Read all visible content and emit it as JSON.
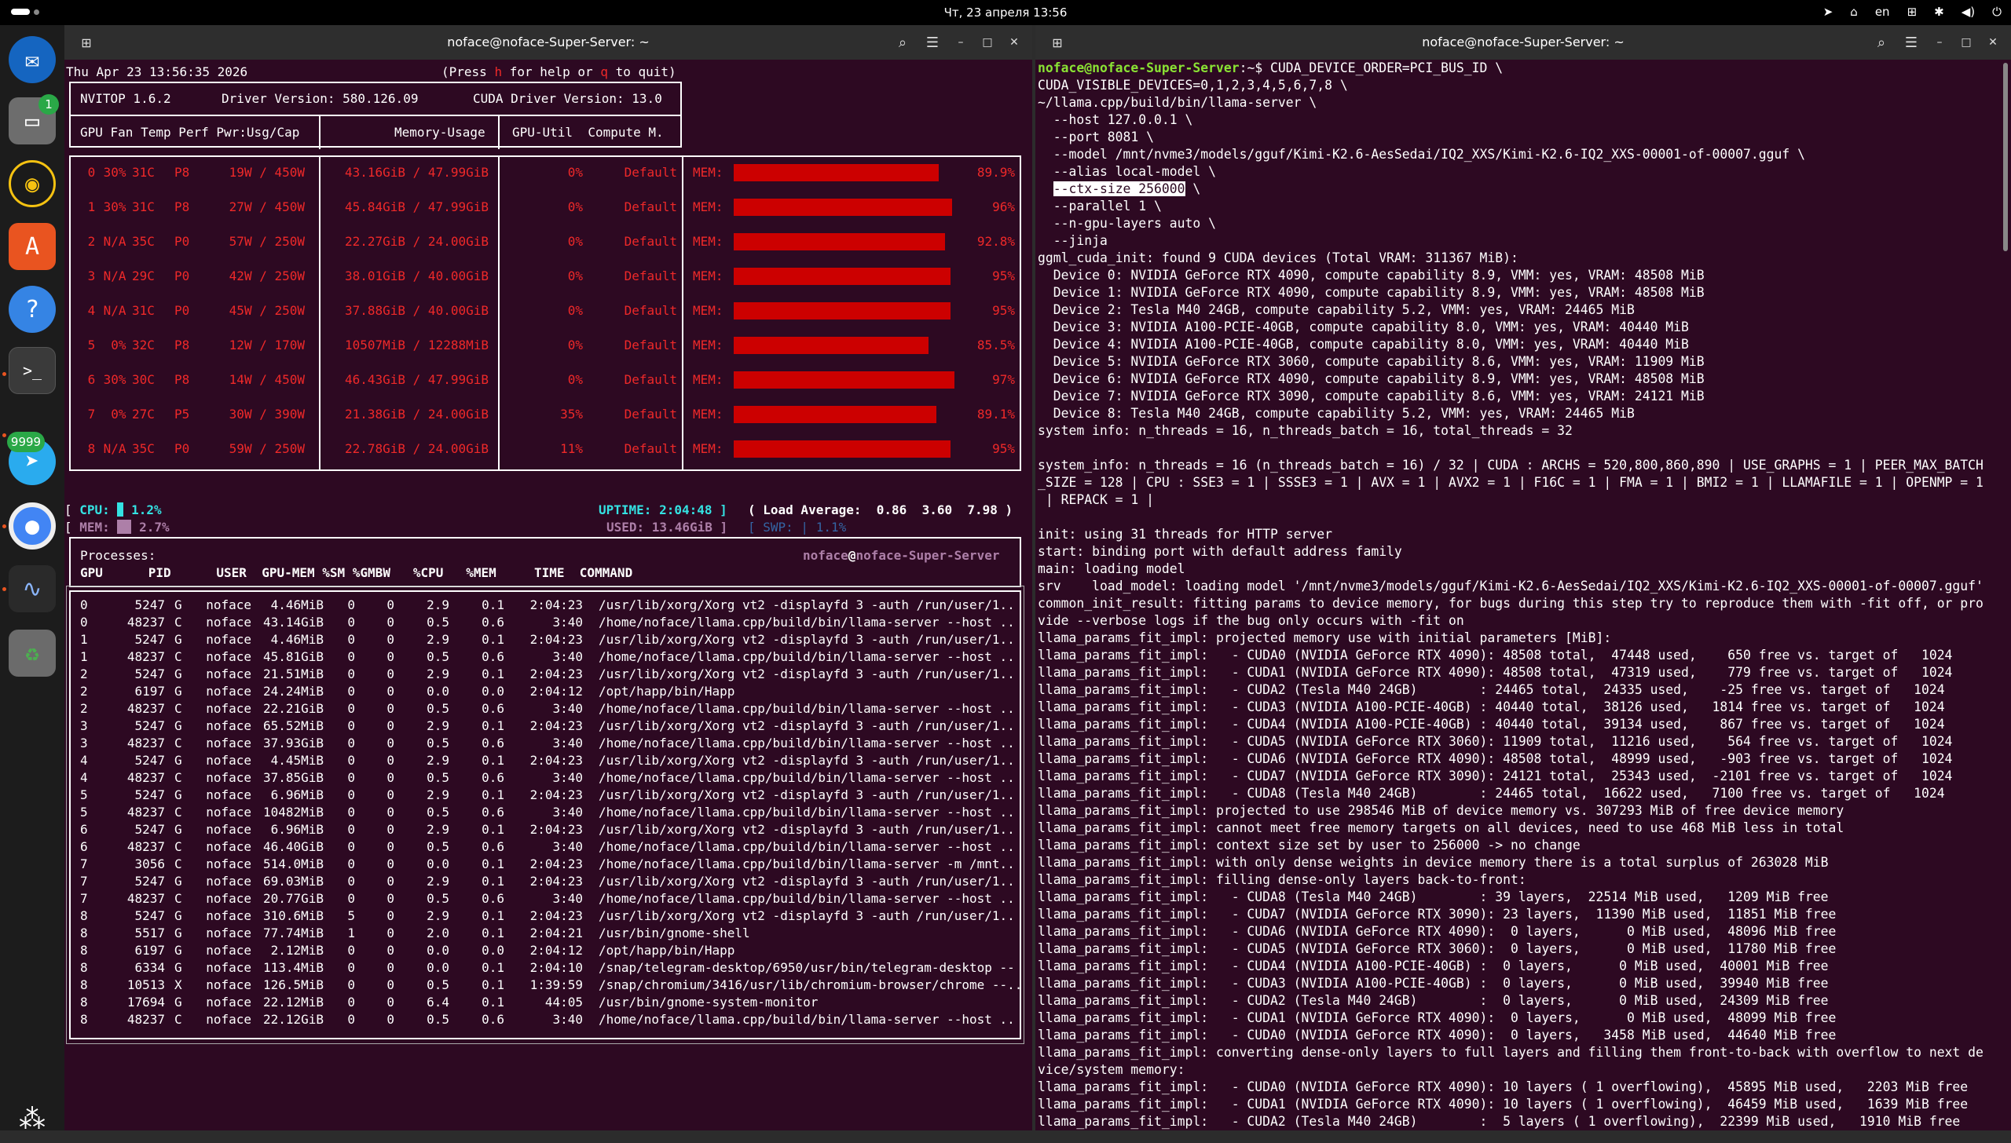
{
  "topbar": {
    "clock": "Чт, 23 апреля 13:56",
    "lang": "en"
  },
  "dock": {
    "badges": {
      "files": "1",
      "telegram": "9999"
    }
  },
  "left_window": {
    "title": "noface@noface-Super-Server: ~",
    "header": {
      "date": "Thu Apr 23 13:56:35 2026",
      "help": "(Press h for help or q to quit)"
    },
    "nvitop": {
      "version": "NVITOP 1.6.2",
      "driver": "Driver Version: 580.126.09",
      "cuda": "CUDA Driver Version: 13.0",
      "col_gpu": "GPU Fan Temp Perf Pwr:Usg/Cap",
      "col_mem": "Memory-Usage",
      "col_util": "GPU-Util  Compute M."
    },
    "gpus": [
      {
        "id": "0",
        "fan": "30%",
        "temp": "31C",
        "perf": "P8",
        "pwr": "19W / 450W",
        "mem": "43.16GiB / 47.99GiB",
        "util": "0%",
        "mode": "Default",
        "pct": "89.9%",
        "frac": 0.899
      },
      {
        "id": "1",
        "fan": "30%",
        "temp": "31C",
        "perf": "P8",
        "pwr": "27W / 450W",
        "mem": "45.84GiB / 47.99GiB",
        "util": "0%",
        "mode": "Default",
        "pct": "96%",
        "frac": 0.96
      },
      {
        "id": "2",
        "fan": "N/A",
        "temp": "35C",
        "perf": "P0",
        "pwr": "57W / 250W",
        "mem": "22.27GiB / 24.00GiB",
        "util": "0%",
        "mode": "Default",
        "pct": "92.8%",
        "frac": 0.928
      },
      {
        "id": "3",
        "fan": "N/A",
        "temp": "29C",
        "perf": "P0",
        "pwr": "42W / 250W",
        "mem": "38.01GiB / 40.00GiB",
        "util": "0%",
        "mode": "Default",
        "pct": "95%",
        "frac": 0.95
      },
      {
        "id": "4",
        "fan": "N/A",
        "temp": "31C",
        "perf": "P0",
        "pwr": "45W / 250W",
        "mem": "37.88GiB / 40.00GiB",
        "util": "0%",
        "mode": "Default",
        "pct": "95%",
        "frac": 0.95
      },
      {
        "id": "5",
        "fan": "0%",
        "temp": "32C",
        "perf": "P8",
        "pwr": "12W / 170W",
        "mem": "10507MiB / 12288MiB",
        "util": "0%",
        "mode": "Default",
        "pct": "85.5%",
        "frac": 0.855
      },
      {
        "id": "6",
        "fan": "30%",
        "temp": "30C",
        "perf": "P8",
        "pwr": "14W / 450W",
        "mem": "46.43GiB / 47.99GiB",
        "util": "0%",
        "mode": "Default",
        "pct": "97%",
        "frac": 0.97
      },
      {
        "id": "7",
        "fan": "0%",
        "temp": "27C",
        "perf": "P5",
        "pwr": "30W / 390W",
        "mem": "21.38GiB / 24.00GiB",
        "util": "35%",
        "mode": "Default",
        "pct": "89.1%",
        "frac": 0.891
      },
      {
        "id": "8",
        "fan": "N/A",
        "temp": "35C",
        "perf": "P0",
        "pwr": "59W / 250W",
        "mem": "22.78GiB / 24.00GiB",
        "util": "11%",
        "mode": "Default",
        "pct": "95%",
        "frac": 0.95
      }
    ],
    "mem_label": "MEM:",
    "host": {
      "cpu_label": "CPU:",
      "cpu": "1.2%",
      "mem_label": "MEM:",
      "mem": "2.7%",
      "uptime": "UPTIME: 2:04:48",
      "used": "USED: 13.46GiB",
      "load_label": "( Load Average:",
      "load1": "0.86",
      "load5": "3.60",
      "load15": "7.98",
      "swp": "SWP:",
      "swp_val": "1.1%"
    },
    "proc_header": {
      "title": "Processes:",
      "user": "noface",
      "host": "noface-Super-Server",
      "cols": "GPU      PID      USER  GPU-MEM %SM %GMBW   %CPU   %MEM     TIME  COMMAND"
    },
    "processes": [
      [
        "0",
        "5247",
        "G",
        "noface",
        "4.46MiB",
        "0",
        "0",
        "2.9",
        "0.1",
        "2:04:23",
        "/usr/lib/xorg/Xorg vt2 -displayfd 3 -auth /run/user/1.."
      ],
      [
        "0",
        "48237",
        "C",
        "noface",
        "43.14GiB",
        "0",
        "0",
        "0.5",
        "0.6",
        "3:40",
        "/home/noface/llama.cpp/build/bin/llama-server --host .."
      ],
      [
        "1",
        "5247",
        "G",
        "noface",
        "4.46MiB",
        "0",
        "0",
        "2.9",
        "0.1",
        "2:04:23",
        "/usr/lib/xorg/Xorg vt2 -displayfd 3 -auth /run/user/1.."
      ],
      [
        "1",
        "48237",
        "C",
        "noface",
        "45.81GiB",
        "0",
        "0",
        "0.5",
        "0.6",
        "3:40",
        "/home/noface/llama.cpp/build/bin/llama-server --host .."
      ],
      [
        "2",
        "5247",
        "G",
        "noface",
        "21.51MiB",
        "0",
        "0",
        "2.9",
        "0.1",
        "2:04:23",
        "/usr/lib/xorg/Xorg vt2 -displayfd 3 -auth /run/user/1.."
      ],
      [
        "2",
        "6197",
        "G",
        "noface",
        "24.24MiB",
        "0",
        "0",
        "0.0",
        "0.0",
        "2:04:12",
        "/opt/happ/bin/Happ"
      ],
      [
        "2",
        "48237",
        "C",
        "noface",
        "22.21GiB",
        "0",
        "0",
        "0.5",
        "0.6",
        "3:40",
        "/home/noface/llama.cpp/build/bin/llama-server --host .."
      ],
      [
        "3",
        "5247",
        "G",
        "noface",
        "65.52MiB",
        "0",
        "0",
        "2.9",
        "0.1",
        "2:04:23",
        "/usr/lib/xorg/Xorg vt2 -displayfd 3 -auth /run/user/1.."
      ],
      [
        "3",
        "48237",
        "C",
        "noface",
        "37.93GiB",
        "0",
        "0",
        "0.5",
        "0.6",
        "3:40",
        "/home/noface/llama.cpp/build/bin/llama-server --host .."
      ],
      [
        "4",
        "5247",
        "G",
        "noface",
        "4.45MiB",
        "0",
        "0",
        "2.9",
        "0.1",
        "2:04:23",
        "/usr/lib/xorg/Xorg vt2 -displayfd 3 -auth /run/user/1.."
      ],
      [
        "4",
        "48237",
        "C",
        "noface",
        "37.85GiB",
        "0",
        "0",
        "0.5",
        "0.6",
        "3:40",
        "/home/noface/llama.cpp/build/bin/llama-server --host .."
      ],
      [
        "5",
        "5247",
        "G",
        "noface",
        "6.96MiB",
        "0",
        "0",
        "2.9",
        "0.1",
        "2:04:23",
        "/usr/lib/xorg/Xorg vt2 -displayfd 3 -auth /run/user/1.."
      ],
      [
        "5",
        "48237",
        "C",
        "noface",
        "10482MiB",
        "0",
        "0",
        "0.5",
        "0.6",
        "3:40",
        "/home/noface/llama.cpp/build/bin/llama-server --host .."
      ],
      [
        "6",
        "5247",
        "G",
        "noface",
        "6.96MiB",
        "0",
        "0",
        "2.9",
        "0.1",
        "2:04:23",
        "/usr/lib/xorg/Xorg vt2 -displayfd 3 -auth /run/user/1.."
      ],
      [
        "6",
        "48237",
        "C",
        "noface",
        "46.40GiB",
        "0",
        "0",
        "0.5",
        "0.6",
        "3:40",
        "/home/noface/llama.cpp/build/bin/llama-server --host .."
      ],
      [
        "7",
        "3056",
        "C",
        "noface",
        "514.0MiB",
        "0",
        "0",
        "0.0",
        "0.1",
        "2:04:23",
        "/home/noface/llama.cpp/build/bin/llama-server -m /mnt.."
      ],
      [
        "7",
        "5247",
        "G",
        "noface",
        "69.03MiB",
        "0",
        "0",
        "2.9",
        "0.1",
        "2:04:23",
        "/usr/lib/xorg/Xorg vt2 -displayfd 3 -auth /run/user/1.."
      ],
      [
        "7",
        "48237",
        "C",
        "noface",
        "20.77GiB",
        "0",
        "0",
        "0.5",
        "0.6",
        "3:40",
        "/home/noface/llama.cpp/build/bin/llama-server --host .."
      ],
      [
        "8",
        "5247",
        "G",
        "noface",
        "310.6MiB",
        "5",
        "0",
        "2.9",
        "0.1",
        "2:04:23",
        "/usr/lib/xorg/Xorg vt2 -displayfd 3 -auth /run/user/1.."
      ],
      [
        "8",
        "5517",
        "G",
        "noface",
        "77.74MiB",
        "1",
        "0",
        "2.0",
        "0.1",
        "2:04:21",
        "/usr/bin/gnome-shell"
      ],
      [
        "8",
        "6197",
        "G",
        "noface",
        "2.12MiB",
        "0",
        "0",
        "0.0",
        "0.0",
        "2:04:12",
        "/opt/happ/bin/Happ"
      ],
      [
        "8",
        "6334",
        "G",
        "noface",
        "113.4MiB",
        "0",
        "0",
        "0.0",
        "0.1",
        "2:04:10",
        "/snap/telegram-desktop/6950/usr/bin/telegram-desktop --"
      ],
      [
        "8",
        "10513",
        "X",
        "noface",
        "126.5MiB",
        "0",
        "0",
        "0.5",
        "0.1",
        "1:39:59",
        "/snap/chromium/3416/usr/lib/chromium-browser/chrome --.."
      ],
      [
        "8",
        "17694",
        "G",
        "noface",
        "22.12MiB",
        "0",
        "0",
        "6.4",
        "0.1",
        "44:05",
        "/usr/bin/gnome-system-monitor"
      ],
      [
        "8",
        "48237",
        "C",
        "noface",
        "22.12GiB",
        "0",
        "0",
        "0.5",
        "0.6",
        "3:40",
        "/home/noface/llama.cpp/build/bin/llama-server --host .."
      ]
    ]
  },
  "right_window": {
    "title": "noface@noface-Super-Server: ~",
    "prompt": "noface@noface-Super-Server",
    "prompt_suffix": ":~$ CUDA_DEVICE_ORDER=PCI_BUS_ID \\",
    "sel_text": "--ctx-size 256000",
    "lines": [
      "CUDA_VISIBLE_DEVICES=0,1,2,3,4,5,6,7,8 \\",
      "~/llama.cpp/build/bin/llama-server \\",
      "  --host 127.0.0.1 \\",
      "  --port 8081 \\",
      "  --model /mnt/nvme3/models/gguf/Kimi-K2.6-AesSedai/IQ2_XXS/Kimi-K2.6-IQ2_XXS-00001-of-00007.gguf \\",
      "  --alias local-model \\",
      "@@SEL@@",
      "  --parallel 1 \\",
      "  --n-gpu-layers auto \\",
      "  --jinja",
      "ggml_cuda_init: found 9 CUDA devices (Total VRAM: 311367 MiB):",
      "  Device 0: NVIDIA GeForce RTX 4090, compute capability 8.9, VMM: yes, VRAM: 48508 MiB",
      "  Device 1: NVIDIA GeForce RTX 4090, compute capability 8.9, VMM: yes, VRAM: 48508 MiB",
      "  Device 2: Tesla M40 24GB, compute capability 5.2, VMM: yes, VRAM: 24465 MiB",
      "  Device 3: NVIDIA A100-PCIE-40GB, compute capability 8.0, VMM: yes, VRAM: 40440 MiB",
      "  Device 4: NVIDIA A100-PCIE-40GB, compute capability 8.0, VMM: yes, VRAM: 40440 MiB",
      "  Device 5: NVIDIA GeForce RTX 3060, compute capability 8.6, VMM: yes, VRAM: 11909 MiB",
      "  Device 6: NVIDIA GeForce RTX 4090, compute capability 8.9, VMM: yes, VRAM: 48508 MiB",
      "  Device 7: NVIDIA GeForce RTX 3090, compute capability 8.6, VMM: yes, VRAM: 24121 MiB",
      "  Device 8: Tesla M40 24GB, compute capability 5.2, VMM: yes, VRAM: 24465 MiB",
      "system info: n_threads = 16, n_threads_batch = 16, total_threads = 32",
      "",
      "system_info: n_threads = 16 (n_threads_batch = 16) / 32 | CUDA : ARCHS = 520,800,860,890 | USE_GRAPHS = 1 | PEER_MAX_BATCH",
      "_SIZE = 128 | CPU : SSE3 = 1 | SSSE3 = 1 | AVX = 1 | AVX2 = 1 | F16C = 1 | FMA = 1 | BMI2 = 1 | LLAMAFILE = 1 | OPENMP = 1",
      " | REPACK = 1 |",
      "",
      "init: using 31 threads for HTTP server",
      "start: binding port with default address family",
      "main: loading model",
      "srv    load_model: loading model '/mnt/nvme3/models/gguf/Kimi-K2.6-AesSedai/IQ2_XXS/Kimi-K2.6-IQ2_XXS-00001-of-00007.gguf'",
      "common_init_result: fitting params to device memory, for bugs during this step try to reproduce them with -fit off, or pro",
      "vide --verbose logs if the bug only occurs with -fit on",
      "llama_params_fit_impl: projected memory use with initial parameters [MiB]:",
      "llama_params_fit_impl:   - CUDA0 (NVIDIA GeForce RTX 4090): 48508 total,  47448 used,    650 free vs. target of   1024",
      "llama_params_fit_impl:   - CUDA1 (NVIDIA GeForce RTX 4090): 48508 total,  47319 used,    779 free vs. target of   1024",
      "llama_params_fit_impl:   - CUDA2 (Tesla M40 24GB)        : 24465 total,  24335 used,    -25 free vs. target of   1024",
      "llama_params_fit_impl:   - CUDA3 (NVIDIA A100-PCIE-40GB) : 40440 total,  38126 used,   1814 free vs. target of   1024",
      "llama_params_fit_impl:   - CUDA4 (NVIDIA A100-PCIE-40GB) : 40440 total,  39134 used,    867 free vs. target of   1024",
      "llama_params_fit_impl:   - CUDA5 (NVIDIA GeForce RTX 3060): 11909 total,  11216 used,    564 free vs. target of   1024",
      "llama_params_fit_impl:   - CUDA6 (NVIDIA GeForce RTX 4090): 48508 total,  48999 used,   -903 free vs. target of   1024",
      "llama_params_fit_impl:   - CUDA7 (NVIDIA GeForce RTX 3090): 24121 total,  25343 used,  -2101 free vs. target of   1024",
      "llama_params_fit_impl:   - CUDA8 (Tesla M40 24GB)        : 24465 total,  16622 used,   7100 free vs. target of   1024",
      "llama_params_fit_impl: projected to use 298546 MiB of device memory vs. 307293 MiB of free device memory",
      "llama_params_fit_impl: cannot meet free memory targets on all devices, need to use 468 MiB less in total",
      "llama_params_fit_impl: context size set by user to 256000 -> no change",
      "llama_params_fit_impl: with only dense weights in device memory there is a total surplus of 263028 MiB",
      "llama_params_fit_impl: filling dense-only layers back-to-front:",
      "llama_params_fit_impl:   - CUDA8 (Tesla M40 24GB)        : 39 layers,  22514 MiB used,   1209 MiB free",
      "llama_params_fit_impl:   - CUDA7 (NVIDIA GeForce RTX 3090): 23 layers,  11390 MiB used,  11851 MiB free",
      "llama_params_fit_impl:   - CUDA6 (NVIDIA GeForce RTX 4090):  0 layers,      0 MiB used,  48096 MiB free",
      "llama_params_fit_impl:   - CUDA5 (NVIDIA GeForce RTX 3060):  0 layers,      0 MiB used,  11780 MiB free",
      "llama_params_fit_impl:   - CUDA4 (NVIDIA A100-PCIE-40GB) :  0 layers,      0 MiB used,  40001 MiB free",
      "llama_params_fit_impl:   - CUDA3 (NVIDIA A100-PCIE-40GB) :  0 layers,      0 MiB used,  39940 MiB free",
      "llama_params_fit_impl:   - CUDA2 (Tesla M40 24GB)        :  0 layers,      0 MiB used,  24309 MiB free",
      "llama_params_fit_impl:   - CUDA1 (NVIDIA GeForce RTX 4090):  0 layers,      0 MiB used,  48099 MiB free",
      "llama_params_fit_impl:   - CUDA0 (NVIDIA GeForce RTX 4090):  0 layers,   3458 MiB used,  44640 MiB free",
      "llama_params_fit_impl: converting dense-only layers to full layers and filling them front-to-back with overflow to next de",
      "vice/system memory:",
      "llama_params_fit_impl:   - CUDA0 (NVIDIA GeForce RTX 4090): 10 layers ( 1 overflowing),  45895 MiB used,   2203 MiB free",
      "llama_params_fit_impl:   - CUDA1 (NVIDIA GeForce RTX 4090): 10 layers ( 1 overflowing),  46459 MiB used,   1639 MiB free",
      "llama_params_fit_impl:   - CUDA2 (Tesla M40 24GB)        :  5 layers ( 1 overflowing),  22399 MiB used,   1910 MiB free"
    ]
  }
}
